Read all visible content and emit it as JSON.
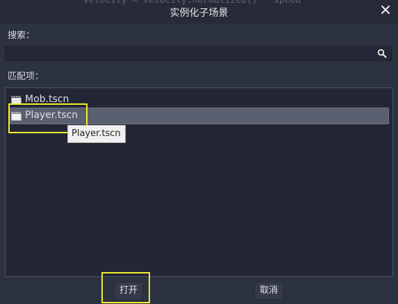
{
  "dialog": {
    "title": "实例化子场景",
    "background_code": "velocity = velocity.normalized() * speed"
  },
  "search": {
    "label": "搜索：",
    "value": "",
    "placeholder": ""
  },
  "matches": {
    "label": "匹配项：",
    "items": [
      {
        "label": "Mob.tscn",
        "icon": "scene-clapper-icon",
        "selected": false
      },
      {
        "label": "Player.tscn",
        "icon": "scene-clapper-icon",
        "selected": true
      }
    ],
    "tooltip": "Player.tscn"
  },
  "buttons": {
    "open": "打开",
    "cancel": "取消"
  },
  "colors": {
    "highlight": "#f3ed2b",
    "selection": "#5b6070",
    "background": "#2d3241"
  }
}
